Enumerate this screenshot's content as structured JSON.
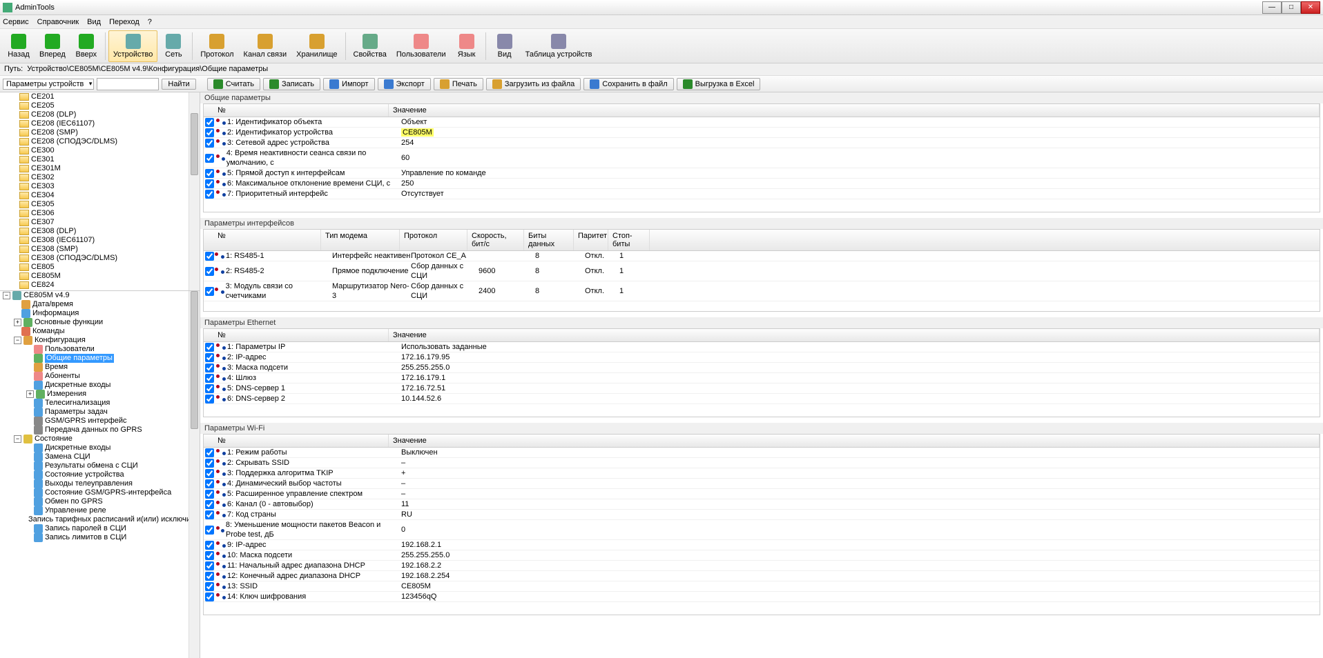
{
  "title": "AdminTools",
  "menu": [
    "Сервис",
    "Справочник",
    "Вид",
    "Переход",
    "?"
  ],
  "toolbar": [
    {
      "label": "Назад",
      "color": "#2a2"
    },
    {
      "label": "Вперед",
      "color": "#2a2"
    },
    {
      "label": "Вверх",
      "color": "#2a2"
    },
    {
      "label": "Устройство",
      "color": "#6aa",
      "active": true
    },
    {
      "label": "Сеть",
      "color": "#6aa"
    },
    {
      "label": "Протокол",
      "color": "#d8a030"
    },
    {
      "label": "Канал связи",
      "color": "#d8a030"
    },
    {
      "label": "Хранилище",
      "color": "#d8a030"
    },
    {
      "label": "Свойства",
      "color": "#6a8"
    },
    {
      "label": "Пользователи",
      "color": "#e88"
    },
    {
      "label": "Язык",
      "color": "#e88"
    },
    {
      "label": "Вид",
      "color": "#88a"
    },
    {
      "label": "Таблица устройств",
      "color": "#88a"
    }
  ],
  "path_label": "Путь:",
  "path_value": "Устройство\\CE805M\\CE805M v4.9\\Конфигурация\\Общие параметры",
  "combo": "Параметры устройств",
  "find_btn": "Найти",
  "actions": [
    {
      "label": "Считать",
      "color": "#2a8a2a"
    },
    {
      "label": "Записать",
      "color": "#2a8a2a"
    },
    {
      "label": "Импорт",
      "color": "#3a7ad0"
    },
    {
      "label": "Экспорт",
      "color": "#3a7ad0"
    },
    {
      "label": "Печать",
      "color": "#d8a030"
    },
    {
      "label": "Загрузить из файла",
      "color": "#d8a030"
    },
    {
      "label": "Сохранить в файл",
      "color": "#3a7ad0"
    },
    {
      "label": "Выгрузка в Excel",
      "color": "#2a8a2a"
    }
  ],
  "tree_top": [
    "CE201",
    "CE205",
    "CE208 (DLP)",
    "CE208 (IEC61107)",
    "CE208 (SMP)",
    "CE208 (СПОДЭС/DLMS)",
    "CE300",
    "CE301",
    "CE301M",
    "CE302",
    "CE303",
    "CE304",
    "CE305",
    "CE306",
    "CE307",
    "CE308 (DLP)",
    "CE308 (IEC61107)",
    "CE308 (SMP)",
    "CE308 (СПОДЭС/DLMS)",
    "CE805",
    "CE805M",
    "CE824"
  ],
  "tree_root": "CE805M v4.9",
  "tree_l1": [
    {
      "label": "Дата/время",
      "ic": "#e0a040"
    },
    {
      "label": "Информация",
      "ic": "#50a0e0"
    },
    {
      "label": "Основные функции",
      "ic": "#60b060",
      "exp": "+"
    },
    {
      "label": "Команды",
      "ic": "#e07050"
    }
  ],
  "tree_cfg": {
    "label": "Конфигурация",
    "ic": "#e0a040",
    "exp": "−"
  },
  "tree_cfg_items": [
    {
      "label": "Пользователи",
      "ic": "#e88"
    },
    {
      "label": "Общие параметры",
      "ic": "#60b060",
      "sel": true
    },
    {
      "label": "Время",
      "ic": "#e0a040"
    },
    {
      "label": "Абоненты",
      "ic": "#e88"
    },
    {
      "label": "Дискретные входы",
      "ic": "#50a0e0"
    },
    {
      "label": "Измерения",
      "ic": "#60b060",
      "exp": "+"
    },
    {
      "label": "Телесигнализация",
      "ic": "#50a0e0"
    },
    {
      "label": "Параметры задач",
      "ic": "#50a0e0"
    },
    {
      "label": "GSM/GPRS интерфейс",
      "ic": "#888"
    },
    {
      "label": "Передача данных по GPRS",
      "ic": "#888"
    }
  ],
  "tree_state": {
    "label": "Состояние",
    "ic": "#e0c040",
    "exp": "−"
  },
  "tree_state_items": [
    "Дискретные входы",
    "Замена СЦИ",
    "Результаты обмена с СЦИ",
    "Состояние устройства",
    "Выходы телеуправления",
    "Состояние GSM/GPRS-интерфейса",
    "Обмен по GPRS",
    "Управление реле",
    "Запись тарифных расписаний и(или) исключител",
    "Запись паролей в СЦИ",
    "Запись лимитов в СЦИ"
  ],
  "sec1": {
    "title": "Общие параметры",
    "headers": {
      "n": "№",
      "v": "Значение"
    },
    "rows": [
      {
        "n": "1: Идентификатор объекта",
        "v": "Объект"
      },
      {
        "n": "2: Идентификатор устройства",
        "v": "CE805M",
        "hl": true
      },
      {
        "n": "3: Сетевой адрес устройства",
        "v": "254"
      },
      {
        "n": "4: Время неактивности сеанса связи по умолчанию, с",
        "v": "60"
      },
      {
        "n": "5: Прямой доступ к интерфейсам",
        "v": "Управление по команде"
      },
      {
        "n": "6: Максимальное отклонение времени СЦИ, с",
        "v": "250"
      },
      {
        "n": "7: Приоритетный интерфейс",
        "v": "Отсутствует"
      }
    ]
  },
  "sec2": {
    "title": "Параметры интерфейсов",
    "headers": [
      "№",
      "Тип модема",
      "Протокол",
      "Скорость, бит/с",
      "Биты данных",
      "Паритет",
      "Стоп-биты"
    ],
    "rows": [
      [
        "1: RS485-1",
        "Интерфейс неактивен",
        "Протокол CE_A",
        "",
        "8",
        "Откл.",
        "1"
      ],
      [
        "2: RS485-2",
        "Прямое подключение",
        "Сбор данных с СЦИ",
        "9600",
        "8",
        "Откл.",
        "1"
      ],
      [
        "3: Модуль связи со счетчиками",
        "Маршрутизатор Nero-3",
        "Сбор данных с СЦИ",
        "2400",
        "8",
        "Откл.",
        "1"
      ]
    ]
  },
  "sec3": {
    "title": "Параметры Ethernet",
    "headers": {
      "n": "№",
      "v": "Значение"
    },
    "rows": [
      {
        "n": "1: Параметры IP",
        "v": "Использовать заданные"
      },
      {
        "n": "2: IP-адрес",
        "v": "172.16.179.95"
      },
      {
        "n": "3: Маска подсети",
        "v": "255.255.255.0"
      },
      {
        "n": "4: Шлюз",
        "v": "172.16.179.1"
      },
      {
        "n": "5: DNS-сервер 1",
        "v": "172.16.72.51"
      },
      {
        "n": "6: DNS-сервер 2",
        "v": "10.144.52.6"
      }
    ]
  },
  "sec4": {
    "title": "Параметры  Wi-Fi",
    "headers": {
      "n": "№",
      "v": "Значение"
    },
    "rows": [
      {
        "n": "1: Режим работы",
        "v": "Выключен"
      },
      {
        "n": "2: Скрывать SSID",
        "v": "–"
      },
      {
        "n": "3: Поддержка алгоритма TKIP",
        "v": "+"
      },
      {
        "n": "4: Динамический выбор частоты",
        "v": "–"
      },
      {
        "n": "5: Расширенное управление спектром",
        "v": "–"
      },
      {
        "n": "6: Канал (0 - автовыбор)",
        "v": "11"
      },
      {
        "n": "7: Код страны",
        "v": "RU"
      },
      {
        "n": "8: Уменьшение мощности пакетов Beacon и Probe test, дБ",
        "v": "0"
      },
      {
        "n": "9: IP-адрес",
        "v": "192.168.2.1"
      },
      {
        "n": "10: Маска подсети",
        "v": "255.255.255.0"
      },
      {
        "n": "11: Начальный адрес диапазона DHCP",
        "v": "192.168.2.2"
      },
      {
        "n": "12: Конечный адрес диапазона DHCP",
        "v": "192.168.2.254"
      },
      {
        "n": "13: SSID",
        "v": "CE805M"
      },
      {
        "n": "14: Ключ шифрования",
        "v": "123456qQ"
      }
    ]
  }
}
